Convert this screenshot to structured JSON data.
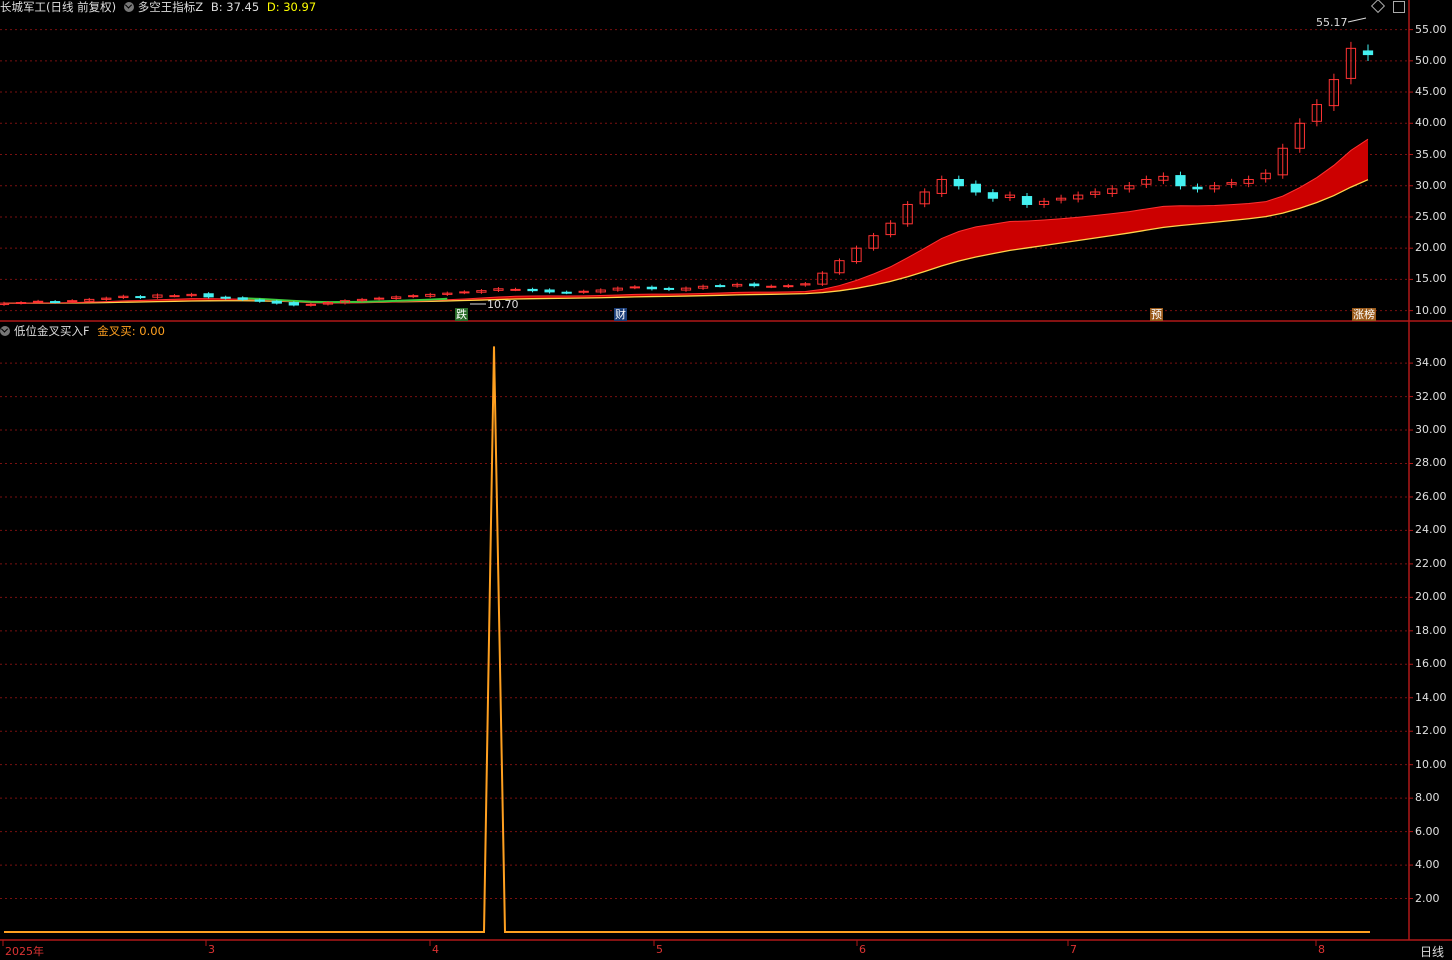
{
  "header_main": {
    "stock_title": "长城军工(日线 前复权)",
    "indicator_name": "多空王指标Z",
    "b_text": "B: 37.45",
    "d_text": "D: 30.97"
  },
  "header_sub": {
    "indicator_name": "低位金叉买入F",
    "value_text": "金叉买: 0.00"
  },
  "main_axis": {
    "ticks": [
      "55.00",
      "50.00",
      "45.00",
      "40.00",
      "35.00",
      "30.00",
      "25.00",
      "20.00",
      "15.00",
      "10.00"
    ],
    "range": [
      8.5,
      57.5
    ]
  },
  "sub_axis": {
    "ticks": [
      "34.00",
      "32.00",
      "30.00",
      "28.00",
      "26.00",
      "24.00",
      "22.00",
      "20.00",
      "18.00",
      "16.00",
      "14.00",
      "12.00",
      "10.00",
      "8.00",
      "6.00",
      "4.00",
      "2.00"
    ],
    "range": [
      0,
      35.5
    ]
  },
  "x_axis": {
    "labels": [
      "2025年",
      "3",
      "4",
      "5",
      "6",
      "7",
      "8"
    ],
    "period_label": "日线"
  },
  "annotations": {
    "high_label": "55.17",
    "low_label": "10.70",
    "tag_die": "跌",
    "tag_cai": "财",
    "tag_yu": "预",
    "tag_zhangting": "涨榜"
  },
  "colors": {
    "up": "#ff3333",
    "down": "#44f0f0",
    "ribbon": "#cc0000",
    "buy_line": "#ffa020",
    "grid": "#7a1010"
  },
  "chart_data": [
    {
      "type": "line",
      "title": "",
      "series": [
        {
          "name": "B",
          "values_end": 37.45
        },
        {
          "name": "D",
          "values_end": 30.97
        }
      ],
      "candles_close": [
        11.2,
        11.3,
        11.5,
        11.4,
        11.6,
        11.8,
        12.0,
        12.3,
        12.1,
        12.5,
        12.4,
        12.6,
        12.2,
        12.0,
        11.8,
        11.5,
        11.2,
        10.9,
        11.0,
        11.3,
        11.6,
        11.8,
        12.0,
        12.2,
        12.4,
        12.6,
        12.8,
        13.0,
        13.2,
        13.5,
        13.4,
        13.2,
        13.0,
        12.9,
        13.1,
        13.3,
        13.6,
        13.8,
        13.5,
        13.4,
        13.6,
        13.9,
        14.0,
        14.2,
        14.0,
        13.9,
        14.0,
        14.3,
        16,
        18,
        20,
        22,
        24,
        27,
        29,
        31,
        30,
        29,
        28,
        28.5,
        27,
        27.5,
        28,
        28.5,
        29,
        29.5,
        30,
        31,
        31.5,
        30,
        29.5,
        30,
        30.5,
        31,
        32,
        36,
        40,
        43,
        47,
        52,
        51
      ],
      "ylim": [
        8.5,
        57.5
      ]
    },
    {
      "type": "line",
      "title": "",
      "series": [
        {
          "name": "金叉买",
          "spike_value": 35.0,
          "baseline": 0.0,
          "current": 0.0
        }
      ],
      "ylim": [
        0,
        35.5
      ]
    }
  ]
}
